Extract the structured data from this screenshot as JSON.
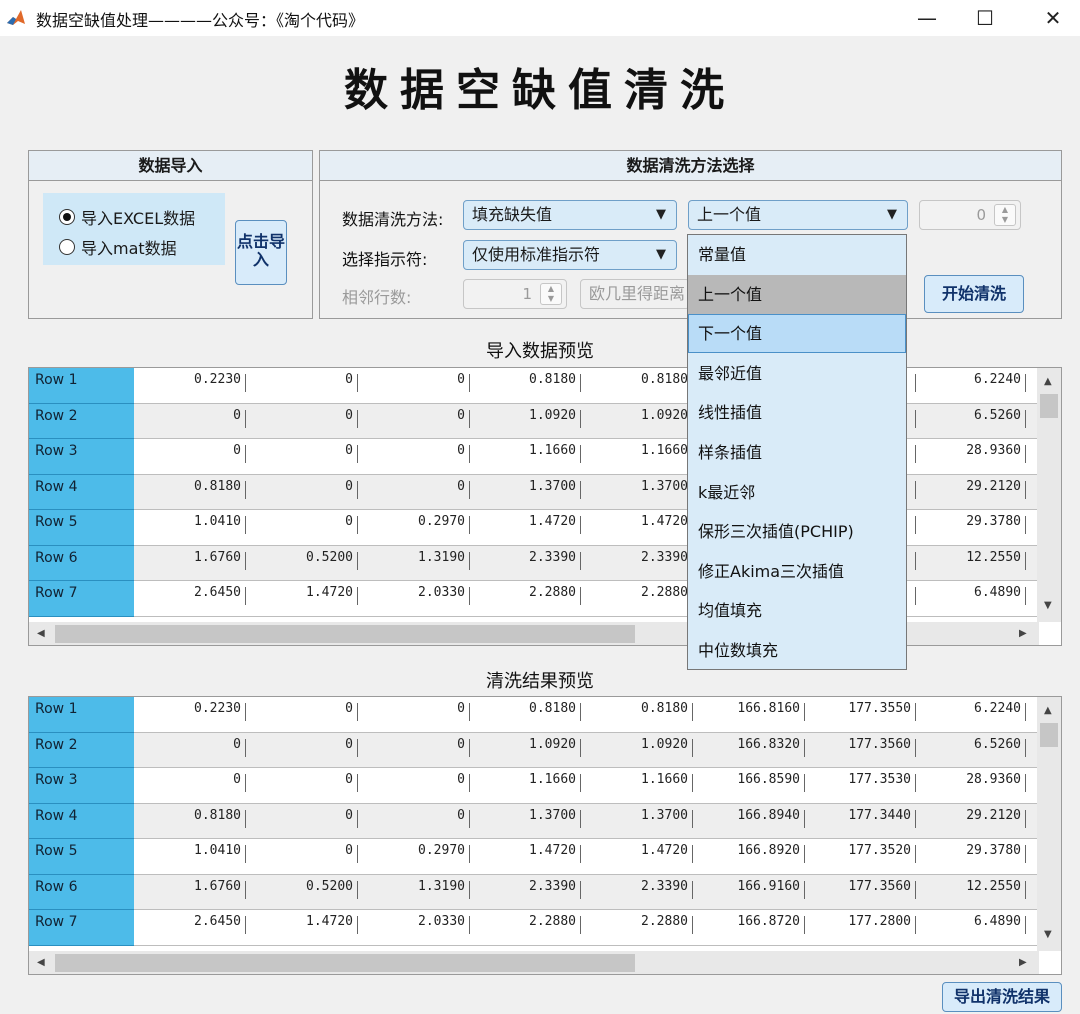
{
  "window": {
    "title": "数据空缺值处理————公众号：《淘个代码》",
    "minimize": "—",
    "maximize": "☐",
    "close": "✕"
  },
  "main_title": "数据空缺值清洗",
  "import_panel": {
    "title": "数据导入",
    "radio_excel": "导入EXCEL数据",
    "radio_mat": "导入mat数据",
    "import_button": "点击导入"
  },
  "method_panel": {
    "title": "数据清洗方法选择",
    "method_label": "数据清洗方法:",
    "method_value": "填充缺失值",
    "fill_value": "上一个值",
    "spin_value": "0",
    "indicator_label": "选择指示符:",
    "indicator_value": "仅使用标准指示符",
    "neighbor_label": "相邻行数:",
    "neighbor_value": "1",
    "distance_value": "欧几里得距离",
    "clean_button": "开始清洗"
  },
  "dropdown": {
    "items": [
      "常量值",
      "上一个值",
      "下一个值",
      "最邻近值",
      "线性插值",
      "样条插值",
      "k最近邻",
      "保形三次插值(PCHIP)",
      "修正Akima三次插值",
      "均值填充",
      "中位数填充"
    ],
    "selected": "上一个值",
    "hover": "下一个值"
  },
  "preview": {
    "title": "导入数据预览",
    "rows": [
      {
        "label": "Row 1",
        "cells": [
          "0.2230",
          "0",
          "0",
          "0.8180",
          "0.8180",
          "",
          "",
          "6.2240"
        ]
      },
      {
        "label": "Row 2",
        "cells": [
          "0",
          "0",
          "0",
          "1.0920",
          "1.0920",
          "",
          "",
          "6.5260"
        ]
      },
      {
        "label": "Row 3",
        "cells": [
          "0",
          "0",
          "0",
          "1.1660",
          "1.1660",
          "",
          "",
          "28.9360"
        ]
      },
      {
        "label": "Row 4",
        "cells": [
          "0.8180",
          "0",
          "0",
          "1.3700",
          "1.3700",
          "",
          "",
          "29.2120"
        ]
      },
      {
        "label": "Row 5",
        "cells": [
          "1.0410",
          "0",
          "0.2970",
          "1.4720",
          "1.4720",
          "",
          "",
          "29.3780"
        ]
      },
      {
        "label": "Row 6",
        "cells": [
          "1.6760",
          "0.5200",
          "1.3190",
          "2.3390",
          "2.3390",
          "",
          "",
          "12.2550"
        ]
      },
      {
        "label": "Row 7",
        "cells": [
          "2.6450",
          "1.4720",
          "2.0330",
          "2.2880",
          "2.2880",
          "",
          "",
          "6.4890"
        ]
      }
    ]
  },
  "result": {
    "title": "清洗结果预览",
    "rows": [
      {
        "label": "Row 1",
        "cells": [
          "0.2230",
          "0",
          "0",
          "0.8180",
          "0.8180",
          "166.8160",
          "177.3550",
          "6.2240"
        ]
      },
      {
        "label": "Row 2",
        "cells": [
          "0",
          "0",
          "0",
          "1.0920",
          "1.0920",
          "166.8320",
          "177.3560",
          "6.5260"
        ]
      },
      {
        "label": "Row 3",
        "cells": [
          "0",
          "0",
          "0",
          "1.1660",
          "1.1660",
          "166.8590",
          "177.3530",
          "28.9360"
        ]
      },
      {
        "label": "Row 4",
        "cells": [
          "0.8180",
          "0",
          "0",
          "1.3700",
          "1.3700",
          "166.8940",
          "177.3440",
          "29.2120"
        ]
      },
      {
        "label": "Row 5",
        "cells": [
          "1.0410",
          "0",
          "0.2970",
          "1.4720",
          "1.4720",
          "166.8920",
          "177.3520",
          "29.3780"
        ]
      },
      {
        "label": "Row 6",
        "cells": [
          "1.6760",
          "0.5200",
          "1.3190",
          "2.3390",
          "2.3390",
          "166.9160",
          "177.3560",
          "12.2550"
        ]
      },
      {
        "label": "Row 7",
        "cells": [
          "2.6450",
          "1.4720",
          "2.0330",
          "2.2880",
          "2.2880",
          "166.8720",
          "177.2800",
          "6.4890"
        ]
      }
    ]
  },
  "export_button": "导出清洗结果",
  "colors": {
    "row_header": "#4dbbe9",
    "button_bg": "#d8ebfa",
    "dropdown_bg": "#d9ebf8"
  }
}
